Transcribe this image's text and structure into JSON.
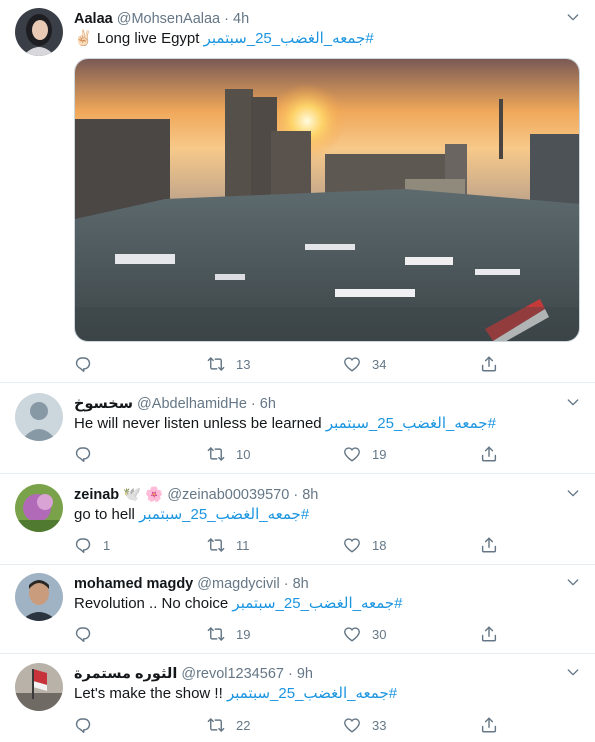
{
  "tweets": [
    {
      "name": "Aalaa",
      "handle": "@MohsenAalaa",
      "sep": "·",
      "time": "4h",
      "emoji": "✌🏻",
      "text": "Long live Egypt",
      "hashtag": "#جمعه_الغضب_25_سبتمبر",
      "replies": "",
      "retweets": "13",
      "likes": "34"
    },
    {
      "name": "سخسوخ",
      "handle": "@AbdelhamidHe",
      "sep": "·",
      "time": "6h",
      "text": "He will never listen unless be learned",
      "hashtag": "#جمعه_الغضب_25_سبتمبر",
      "replies": "",
      "retweets": "10",
      "likes": "19"
    },
    {
      "name": "zeinab",
      "name_emoji": "🕊️ 🌸",
      "handle": "@zeinab00039570",
      "sep": "·",
      "time": "8h",
      "text": "go to hell",
      "hashtag": "#جمعه_الغضب_25_سبتمبر",
      "replies": "1",
      "retweets": "11",
      "likes": "18"
    },
    {
      "name": "mohamed magdy",
      "handle": "@magdycivil",
      "sep": "·",
      "time": "8h",
      "text": "Revolution .. No choice",
      "hashtag": "#جمعه_الغضب_25_سبتمبر",
      "replies": "",
      "retweets": "19",
      "likes": "30"
    },
    {
      "name": "الثوره مستمرة",
      "handle": "@revol1234567",
      "sep": "·",
      "time": "9h",
      "text": "Let's make the show !!",
      "hashtag": "#جمعه_الغضب_25_سبتمبر",
      "replies": "",
      "retweets": "22",
      "likes": "33"
    }
  ],
  "icons": {
    "reply": "reply-icon",
    "retweet": "retweet-icon",
    "like": "heart-icon",
    "share": "share-icon",
    "more": "chevron-down-icon"
  },
  "colors": {
    "link": "#1b95e0",
    "muted": "#657786",
    "divider": "#e6ecf0"
  }
}
